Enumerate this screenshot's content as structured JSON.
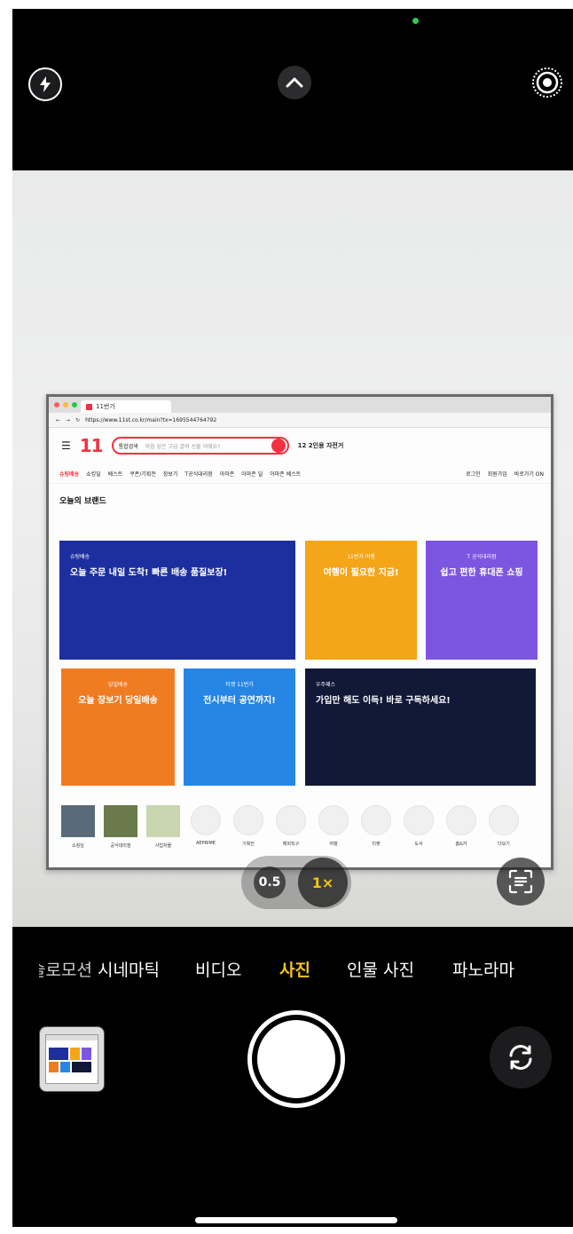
{
  "camera": {
    "modes": [
      "슬로모션",
      "시네마틱",
      "비디오",
      "사진",
      "인물 사진",
      "파노라마"
    ],
    "active_mode": "사진",
    "zoom_levels": [
      "0.5",
      "1×"
    ],
    "active_zoom": "1×"
  },
  "browser": {
    "tab_title": "11번가",
    "url": "https://www.11st.co.kr/main?tx=1695544764792",
    "logo": "11",
    "search_scope": "통합검색",
    "search_placeholder": "마음 담은 고급 굴비 선물 어때요?",
    "trending": "12 2인용 자전거",
    "nav_items": [
      "슈팅배송",
      "쇼킹딜",
      "베스트",
      "쿠폰/기획전",
      "장보기",
      "T공식대리점",
      "아마존",
      "아마존 딜",
      "아마존 베스트"
    ],
    "nav_right": [
      "로그인",
      "회원가입",
      "바로가기 ON"
    ],
    "section_title": "오늘의 브랜드",
    "banners": [
      {
        "small": "슈팅배송",
        "text": "오늘 주문 내일 도착! 빠른 배송 품질보장!"
      },
      {
        "small": "11번가 여행",
        "text": "여행이 필요한 지금!"
      },
      {
        "small": "T 공식대리점",
        "text": "쉽고 편한 휴대폰 쇼핑"
      },
      {
        "small": "당일배송",
        "text": "오늘 장보기 당일배송"
      },
      {
        "small": "티켓 11번가",
        "text": "전시부터 공연까지!"
      },
      {
        "small": "우주패스",
        "text": "가입만 해도 이득! 바로 구독하세요!"
      }
    ],
    "icons": [
      "쇼킹딜",
      "공식대리점",
      "사업자몰",
      "AEPRIME",
      "기획전",
      "해외직구",
      "여행",
      "티켓",
      "도서",
      "홈&카",
      "더보기"
    ]
  }
}
